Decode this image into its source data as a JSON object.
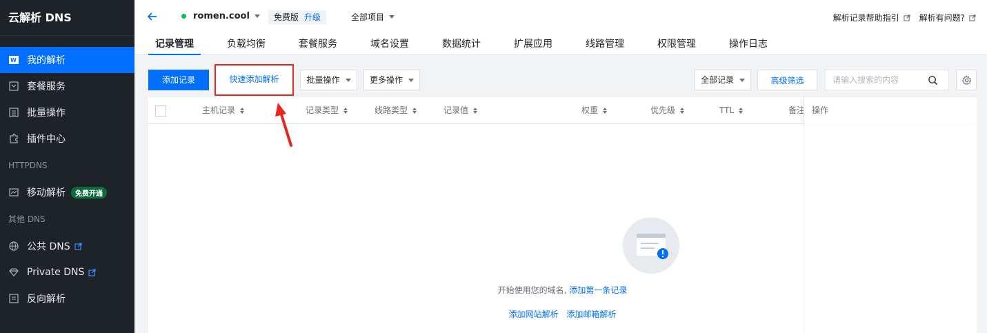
{
  "sidebar": {
    "brand": "云解析 DNS",
    "items": [
      {
        "label": "我的解析",
        "icon": "my-dns-icon",
        "active": true
      },
      {
        "label": "套餐服务",
        "icon": "package-icon"
      },
      {
        "label": "批量操作",
        "icon": "batch-icon"
      },
      {
        "label": "插件中心",
        "icon": "plugin-icon"
      }
    ],
    "section_httpdns": "HTTPDNS",
    "mobile": {
      "label": "移动解析",
      "badge": "免费开通",
      "icon": "mobile-dns-icon"
    },
    "section_other": "其他 DNS",
    "other_items": [
      {
        "label": "公共 DNS",
        "icon": "globe-icon"
      },
      {
        "label": "Private DNS",
        "icon": "diamond-icon"
      },
      {
        "label": "反向解析",
        "icon": "reverse-icon"
      }
    ]
  },
  "header": {
    "domain": "romen.cool",
    "plan": "免费版",
    "upgrade": "升级",
    "project": "全部项目",
    "help_link": "解析记录帮助指引",
    "question_link": "解析有问题?"
  },
  "tabs": [
    "记录管理",
    "负载均衡",
    "套餐服务",
    "域名设置",
    "数据统计",
    "扩展应用",
    "线路管理",
    "权限管理",
    "操作日志"
  ],
  "toolbar": {
    "add_record": "添加记录",
    "quick_add": "快速添加解析",
    "batch_ops": "批量操作",
    "more_ops": "更多操作",
    "all_records": "全部记录",
    "advanced_filter": "高级筛选",
    "search_placeholder": "请输入搜索的内容"
  },
  "table": {
    "columns": [
      "主机记录",
      "记录类型",
      "线路类型",
      "记录值",
      "权重",
      "优先级",
      "TTL",
      "备注"
    ],
    "op_column": "操作",
    "empty_text": "开始使用您的域名,",
    "empty_link": "添加第一条记录",
    "site_link": "添加网站解析",
    "mail_link": "添加邮箱解析"
  },
  "colors": {
    "accent": "#006eff",
    "sidebar_bg": "#1e2329",
    "highlight_box": "#e8261e"
  }
}
